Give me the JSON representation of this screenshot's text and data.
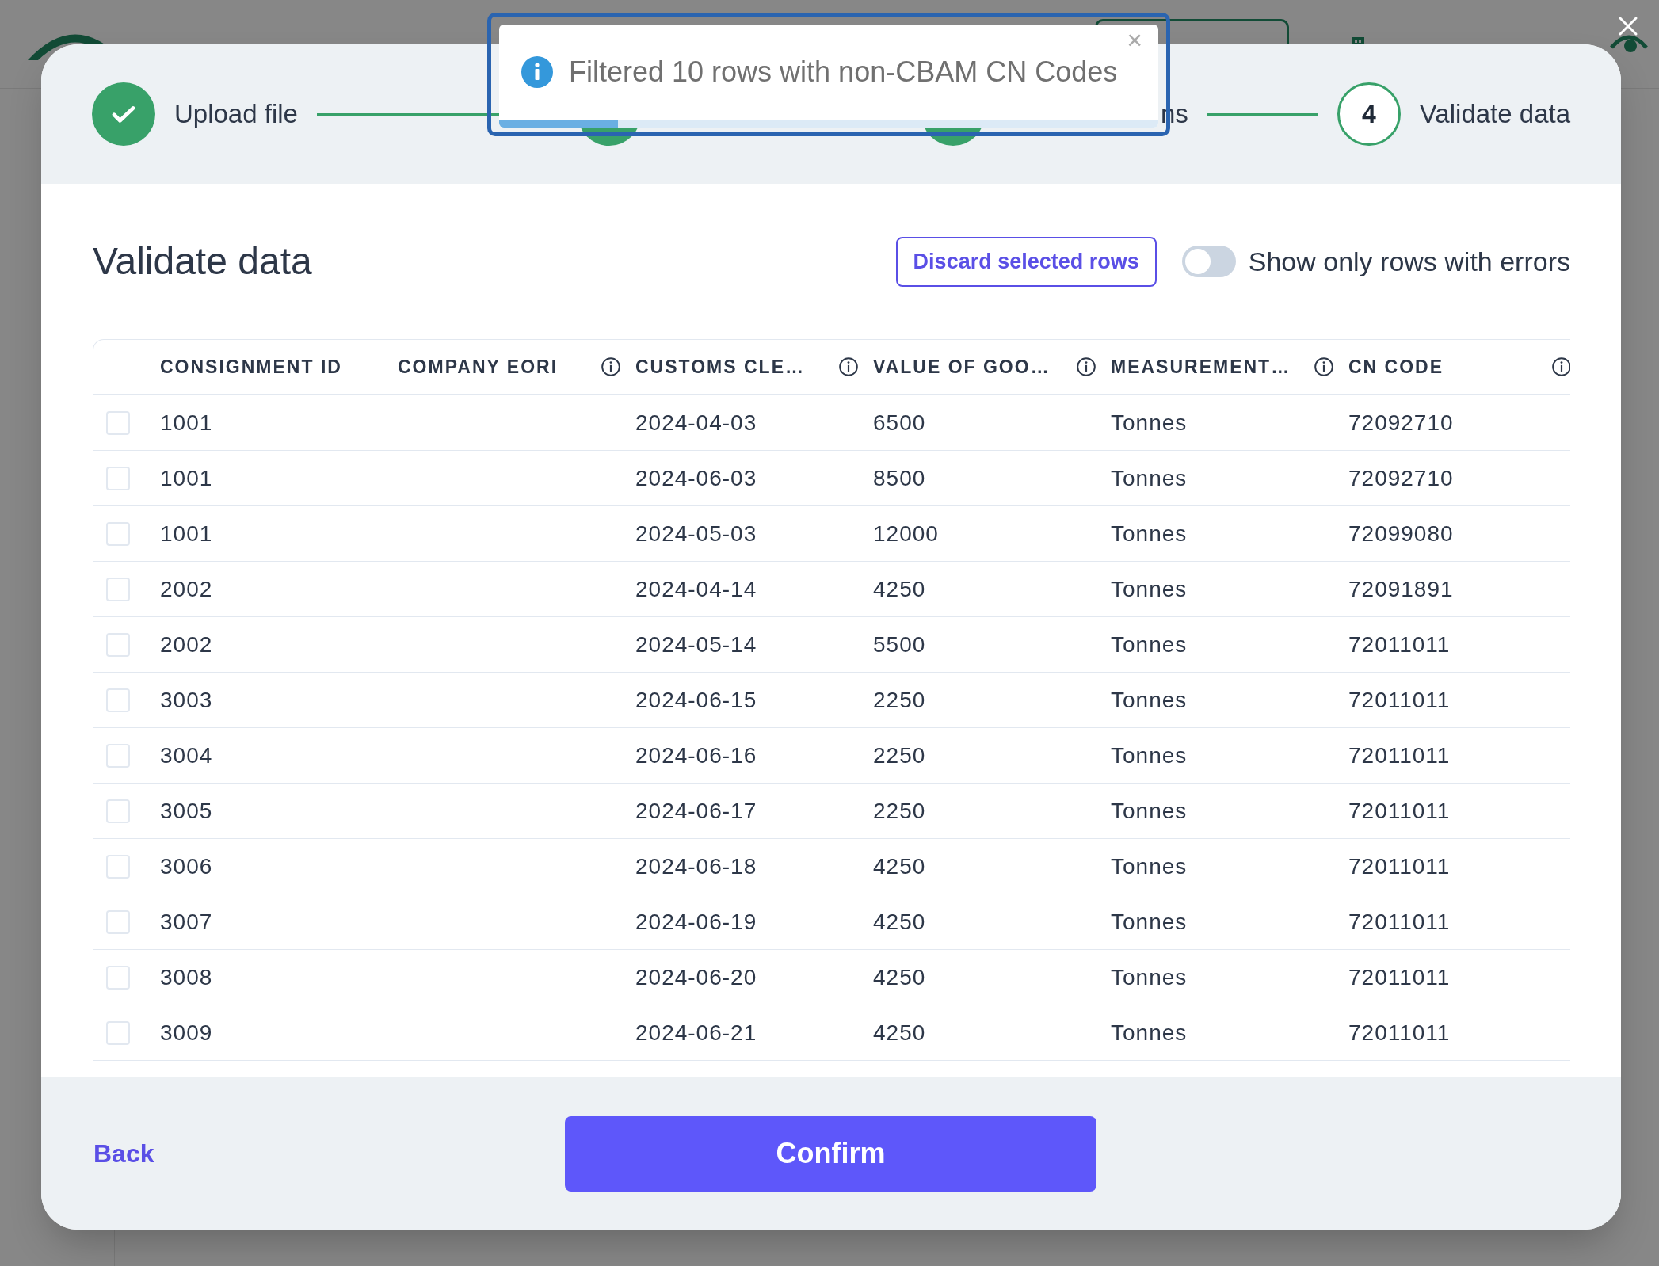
{
  "toast": {
    "message": "Filtered 10 rows with non-CBAM CN Codes",
    "close": "×",
    "level": 0.18
  },
  "steps": [
    {
      "label": "Upload file",
      "done": true
    },
    {
      "done": true
    },
    {
      "label": "ns",
      "done": true
    },
    {
      "label": "Validate data",
      "number": "4",
      "done": false
    }
  ],
  "title": "Validate data",
  "discard_button": "Discard selected rows",
  "errors_toggle": {
    "label": "Show only rows with errors",
    "on": false
  },
  "table": {
    "columns": [
      {
        "label": "CONSIGNMENT ID",
        "info": false
      },
      {
        "label": "COMPANY EORI",
        "info": true
      },
      {
        "label": "CUSTOMS CLE…",
        "info": true
      },
      {
        "label": "VALUE OF GOO…",
        "info": true
      },
      {
        "label": "MEASUREMENT…",
        "info": true
      },
      {
        "label": "CN CODE",
        "info": true
      }
    ],
    "rows": [
      {
        "checked": false,
        "cells": [
          "1001",
          "",
          "2024-04-03",
          "6500",
          "Tonnes",
          "72092710"
        ]
      },
      {
        "checked": false,
        "cells": [
          "1001",
          "",
          "2024-06-03",
          "8500",
          "Tonnes",
          "72092710"
        ]
      },
      {
        "checked": false,
        "cells": [
          "1001",
          "",
          "2024-05-03",
          "12000",
          "Tonnes",
          "72099080"
        ]
      },
      {
        "checked": false,
        "cells": [
          "2002",
          "",
          "2024-04-14",
          "4250",
          "Tonnes",
          "72091891"
        ]
      },
      {
        "checked": false,
        "cells": [
          "2002",
          "",
          "2024-05-14",
          "5500",
          "Tonnes",
          "72011011"
        ]
      },
      {
        "checked": false,
        "cells": [
          "3003",
          "",
          "2024-06-15",
          "2250",
          "Tonnes",
          "72011011"
        ]
      },
      {
        "checked": false,
        "cells": [
          "3004",
          "",
          "2024-06-16",
          "2250",
          "Tonnes",
          "72011011"
        ]
      },
      {
        "checked": false,
        "cells": [
          "3005",
          "",
          "2024-06-17",
          "2250",
          "Tonnes",
          "72011011"
        ]
      },
      {
        "checked": false,
        "cells": [
          "3006",
          "",
          "2024-06-18",
          "4250",
          "Tonnes",
          "72011011"
        ]
      },
      {
        "checked": false,
        "cells": [
          "3007",
          "",
          "2024-06-19",
          "4250",
          "Tonnes",
          "72011011"
        ]
      },
      {
        "checked": false,
        "cells": [
          "3008",
          "",
          "2024-06-20",
          "4250",
          "Tonnes",
          "72011011"
        ]
      },
      {
        "checked": false,
        "cells": [
          "3009",
          "",
          "2024-06-21",
          "4250",
          "Tonnes",
          "72011011"
        ]
      }
    ]
  },
  "back_link": "Back",
  "confirm_button": "Confirm"
}
